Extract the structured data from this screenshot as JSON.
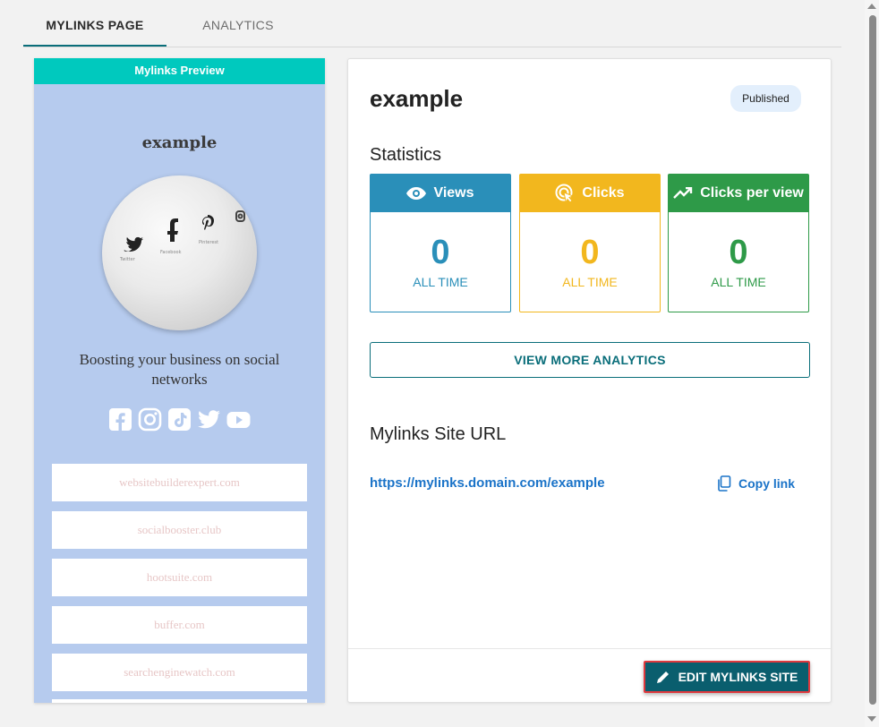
{
  "tabs": [
    {
      "label": "MYLINKS PAGE",
      "active": true
    },
    {
      "label": "ANALYTICS",
      "active": false
    }
  ],
  "preview": {
    "header": "Mylinks Preview",
    "title": "example",
    "image_icons": [
      "twitter-icon",
      "facebook-icon",
      "pinterest-icon",
      "instagram-icon"
    ],
    "description": "Boosting your business on social networks",
    "social_icons": [
      "facebook-icon",
      "instagram-icon",
      "tiktok-icon",
      "twitter-icon",
      "youtube-icon"
    ],
    "links": [
      "websitebuilderexpert.com",
      "socialbooster.club",
      "hootsuite.com",
      "buffer.com",
      "searchenginewatch.com"
    ],
    "colors": {
      "background": "#b6cbee",
      "header": "#00c9be",
      "link_text": "#e7c7c7"
    }
  },
  "site": {
    "title": "example",
    "status": "Published"
  },
  "statistics": {
    "title": "Statistics",
    "cards": [
      {
        "label": "Views",
        "icon": "eye-icon",
        "value": "0",
        "period": "ALL TIME",
        "color": "#2a8fb9"
      },
      {
        "label": "Clicks",
        "icon": "click-icon",
        "value": "0",
        "period": "ALL TIME",
        "color": "#f2b71e"
      },
      {
        "label": "Clicks per view",
        "icon": "trending-up-icon",
        "value": "0",
        "period": "ALL TIME",
        "color": "#2e9a48"
      }
    ]
  },
  "actions": {
    "view_more": "VIEW MORE ANALYTICS",
    "edit": "EDIT MYLINKS SITE",
    "copy": "Copy link"
  },
  "url_section": {
    "title": "Mylinks Site URL",
    "url": "https://mylinks.domain.com/example"
  }
}
